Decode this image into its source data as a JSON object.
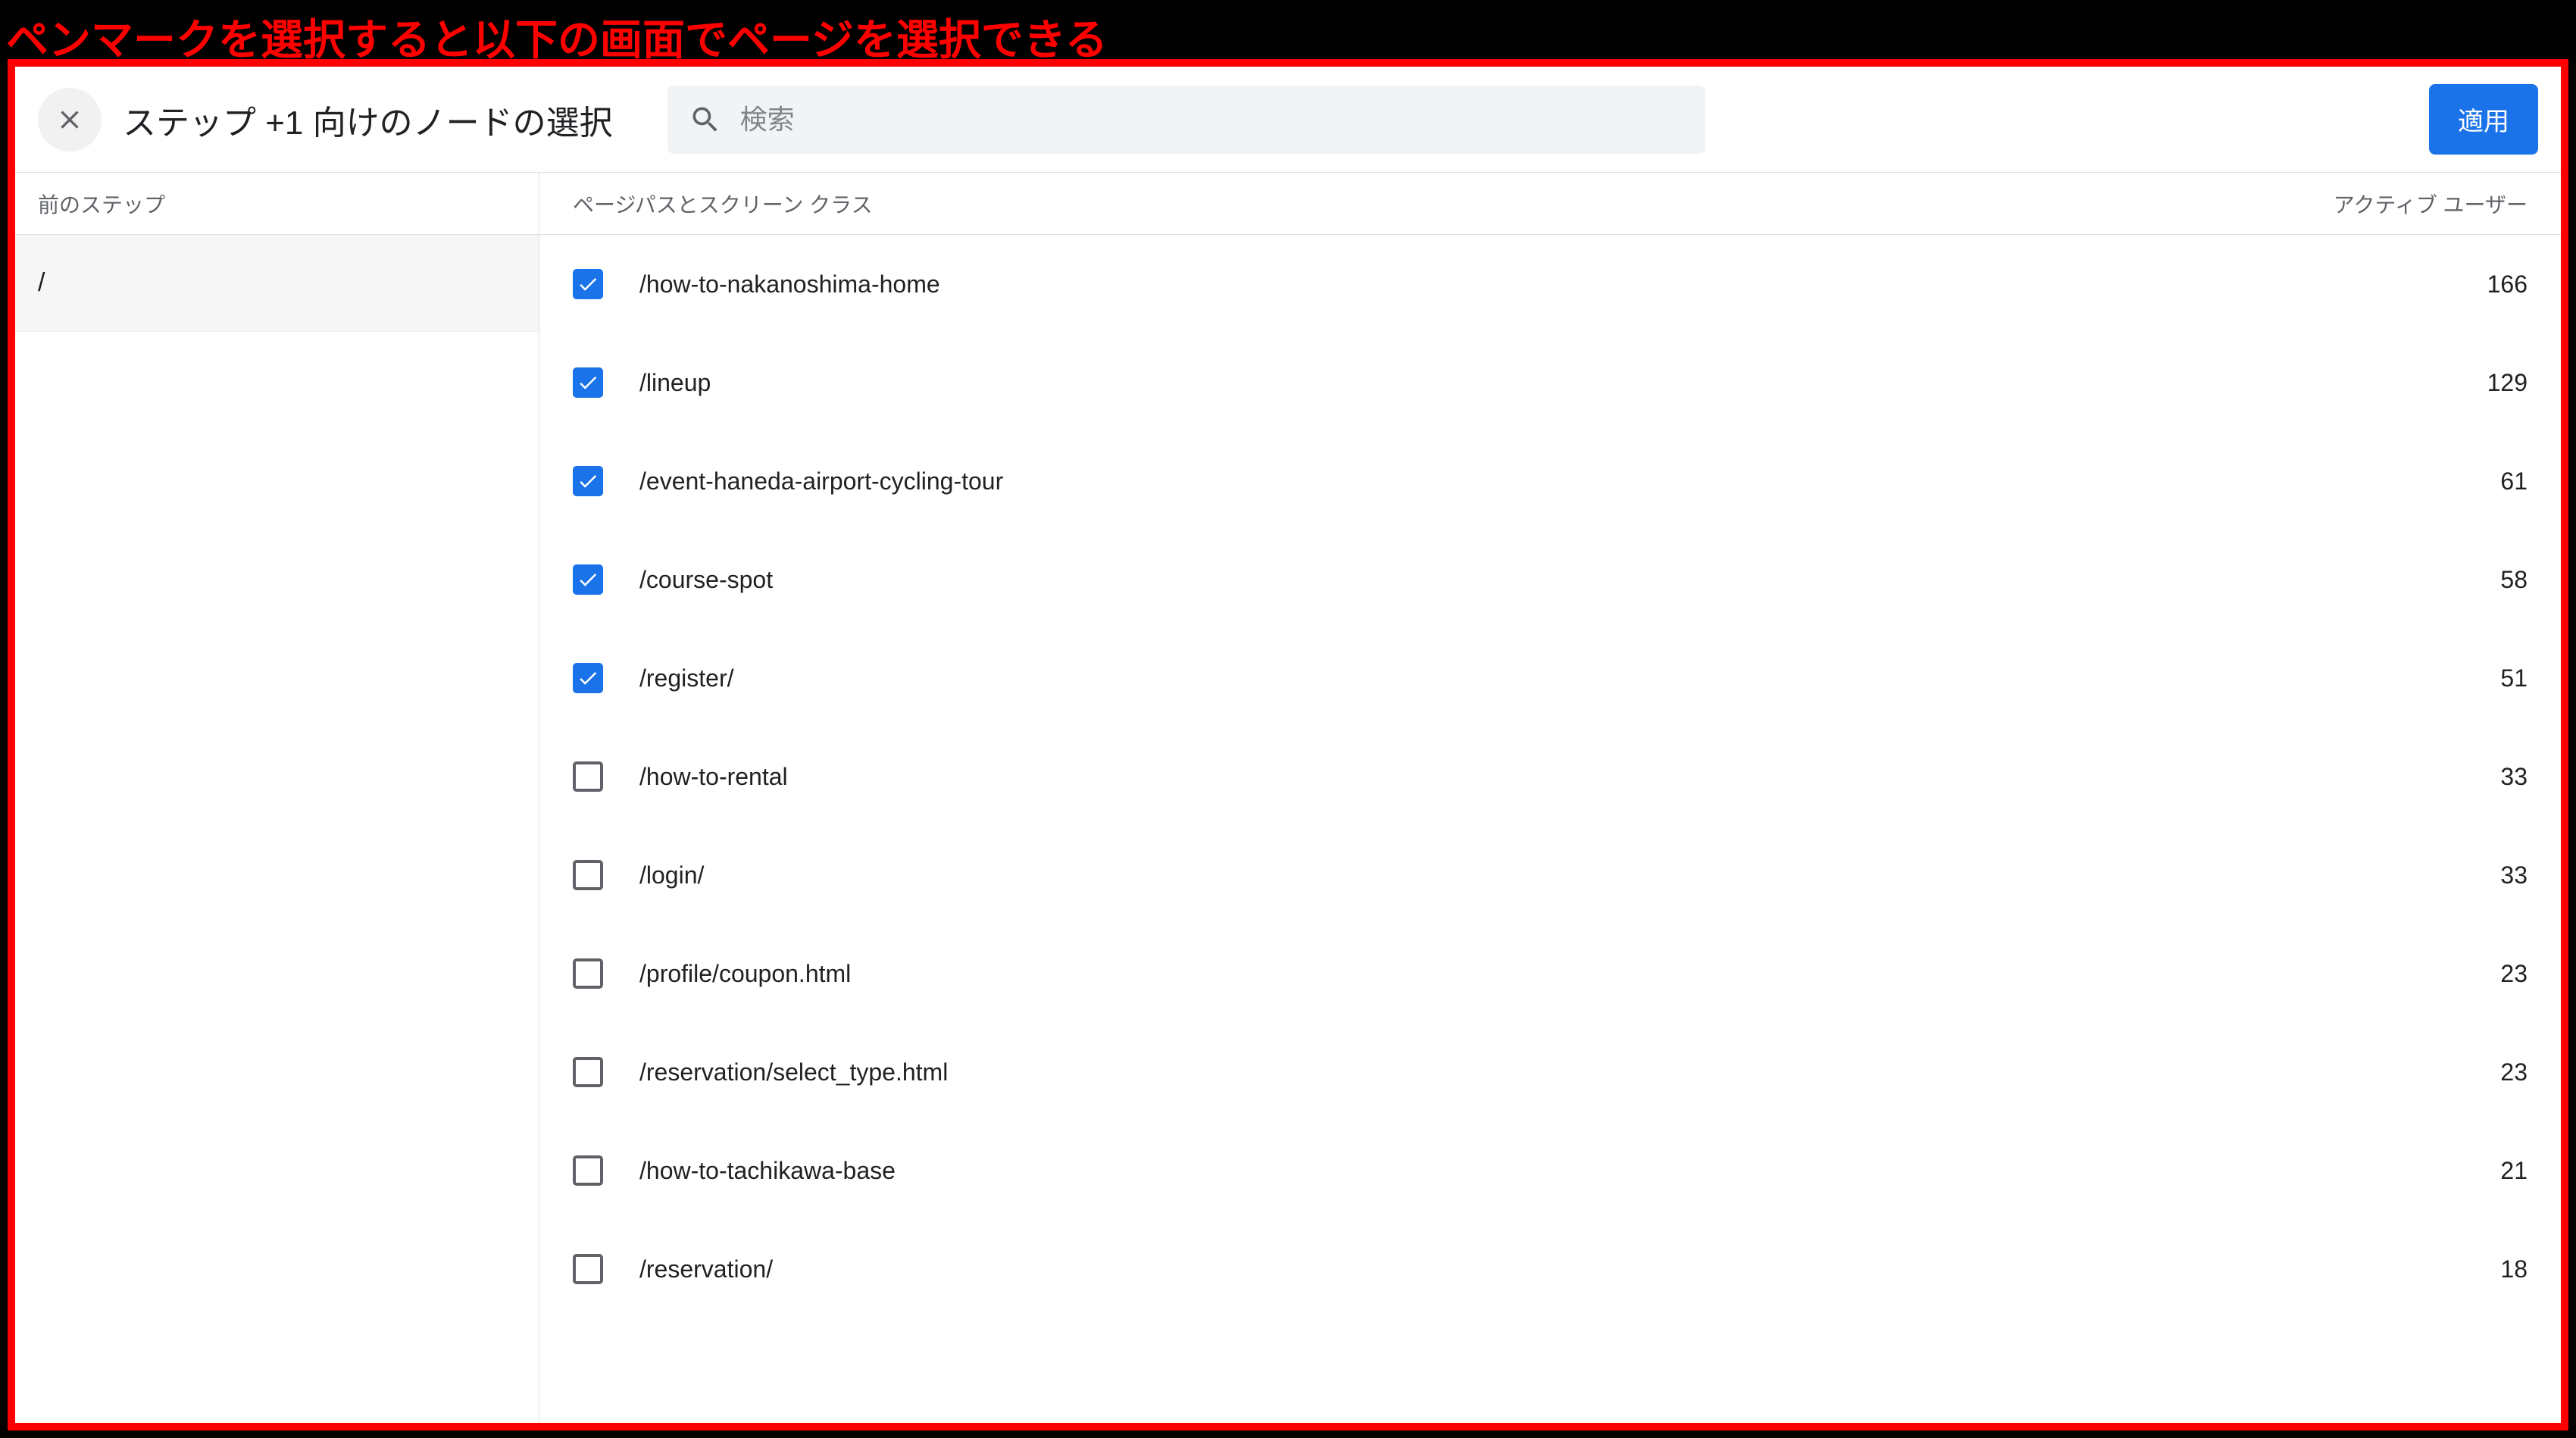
{
  "annotation": "ペンマークを選択すると以下の画面でページを選択できる",
  "header": {
    "title": "ステップ +1 向けのノードの選択",
    "search_placeholder": "検索",
    "apply_label": "適用"
  },
  "left": {
    "heading": "前のステップ",
    "rows": [
      "/"
    ]
  },
  "columns": {
    "path_label": "ページパスとスクリーン クラス",
    "users_label": "アクティブ ユーザー"
  },
  "rows": [
    {
      "checked": true,
      "path": "/how-to-nakanoshima-home",
      "users": 166
    },
    {
      "checked": true,
      "path": "/lineup",
      "users": 129
    },
    {
      "checked": true,
      "path": "/event-haneda-airport-cycling-tour",
      "users": 61
    },
    {
      "checked": true,
      "path": "/course-spot",
      "users": 58
    },
    {
      "checked": true,
      "path": "/register/",
      "users": 51
    },
    {
      "checked": false,
      "path": "/how-to-rental",
      "users": 33
    },
    {
      "checked": false,
      "path": "/login/",
      "users": 33
    },
    {
      "checked": false,
      "path": "/profile/coupon.html",
      "users": 23
    },
    {
      "checked": false,
      "path": "/reservation/select_type.html",
      "users": 23
    },
    {
      "checked": false,
      "path": "/how-to-tachikawa-base",
      "users": 21
    },
    {
      "checked": false,
      "path": "/reservation/",
      "users": 18
    }
  ]
}
